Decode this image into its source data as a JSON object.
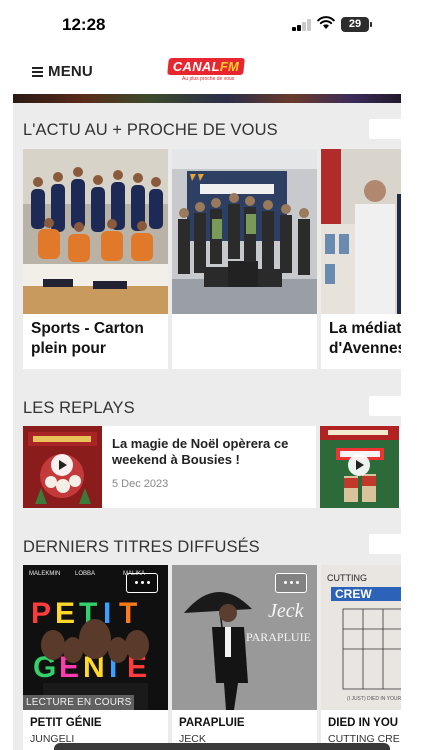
{
  "status_bar": {
    "time": "12:28",
    "battery": "29"
  },
  "header": {
    "menu_label": "MENU",
    "logo": {
      "text_main": "CANAL",
      "text_accent": "FM",
      "tagline": "Au plus proche de vous"
    }
  },
  "sections": {
    "news": {
      "title": "L'ACTU AU + PROCHE DE VOUS",
      "cards": [
        {
          "title": "Sports - Carton plein pour Aulnoye Basket et la Team Avesnois Cyclis..."
        },
        {
          "title": ""
        },
        {
          "title": "La médiat d'Avennes"
        }
      ]
    },
    "replays": {
      "title": "LES REPLAYS",
      "items": [
        {
          "title": "La magie de Noël opèrera ce weekend à Bousies !",
          "date": "5 Dec 2023"
        }
      ]
    },
    "tracks": {
      "title": "DERNIERS TITRES DIFFUSÉS",
      "now_playing_label": "LECTURE EN COURS",
      "items": [
        {
          "title": "PETIT GÉNIE",
          "artist": "JUNGELI"
        },
        {
          "title": "PARAPLUIE",
          "artist": "JECK"
        },
        {
          "title": "DIED IN YOU",
          "artist": "CUTTING CRE"
        }
      ]
    }
  },
  "colors": {
    "accent": "#e8262f",
    "logo_yellow": "#ffd42a",
    "content_bg": "#ececec"
  }
}
